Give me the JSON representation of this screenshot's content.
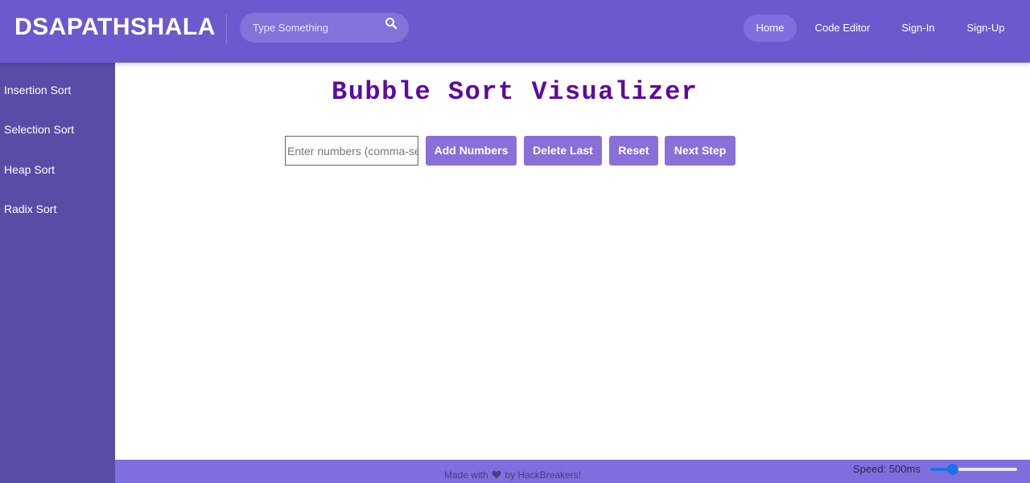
{
  "header": {
    "brand": "DSAPATHSHALA",
    "search": {
      "placeholder": "Type Something",
      "value": ""
    },
    "nav": {
      "home": "Home",
      "code_editor": "Code Editor",
      "sign_in": "Sign-In",
      "sign_up": "Sign-Up"
    }
  },
  "sidebar": {
    "items": [
      {
        "label": "Insertion Sort"
      },
      {
        "label": "Selection Sort"
      },
      {
        "label": "Heap Sort"
      },
      {
        "label": "Radix Sort"
      }
    ]
  },
  "main": {
    "title": "Bubble Sort Visualizer",
    "input": {
      "placeholder": "Enter numbers (comma-separated)",
      "value": ""
    },
    "buttons": {
      "add": "Add Numbers",
      "delete": "Delete Last",
      "reset": "Reset",
      "next": "Next Step"
    }
  },
  "footer": {
    "made_with": "Made with",
    "by": "by HackBreakers!",
    "speed_label": "Speed: 500ms",
    "speed_slider_fraction": 0.26
  },
  "colors": {
    "navbar": "#6a5acd",
    "sidebar": "#584da6",
    "button": "#8a6fd8",
    "title": "#5e0aa0",
    "footer": "#7f6fde",
    "slider_accent": "#1a73e8"
  },
  "icons": {
    "search": "search-icon",
    "heart": "heart-icon"
  }
}
